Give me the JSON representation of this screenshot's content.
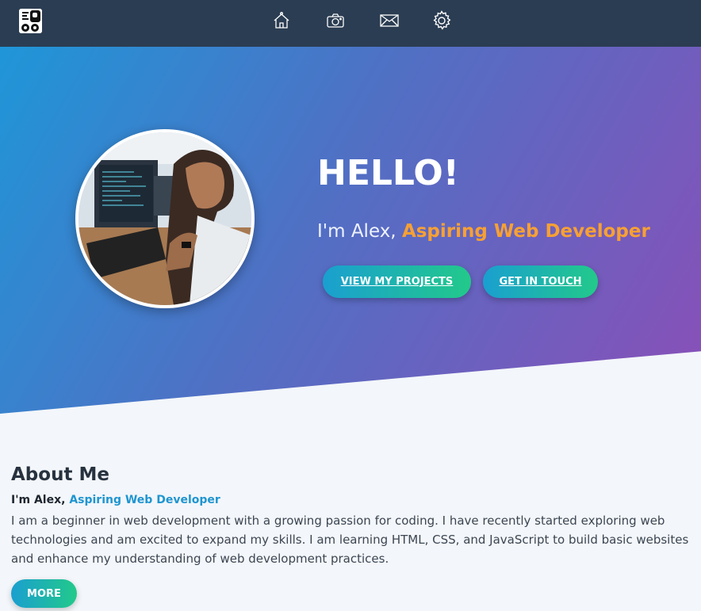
{
  "nav": {
    "logo_icon": "brand-logo",
    "items": [
      {
        "icon": "home-icon"
      },
      {
        "icon": "camera-icon"
      },
      {
        "icon": "mail-icon"
      },
      {
        "icon": "gear-icon"
      }
    ],
    "background": "#2b3d52"
  },
  "hero": {
    "title": "HELLO!",
    "intro": "I'm Alex, ",
    "role": "Aspiring Web Developer",
    "role_color": "#f7a034",
    "buttons": {
      "projects": "VIEW MY PROJECTS",
      "contact": "GET IN TOUCH"
    },
    "gradient": [
      "#1f96d8",
      "#5070c4",
      "#8a4fb8"
    ]
  },
  "about": {
    "title": "About Me",
    "intro": "I'm Alex, ",
    "role": "Aspiring Web Developer",
    "role_color": "#1f95d0",
    "text": "I am a beginner in web development with a growing passion for coding. I have recently started exploring web technologies and am excited to expand my skills. I am learning HTML, CSS, and JavaScript to build basic websites and enhance my understanding of web development practices.",
    "more_button": "MORE"
  },
  "button_gradient": [
    "#1a9fd0",
    "#22c98a"
  ]
}
